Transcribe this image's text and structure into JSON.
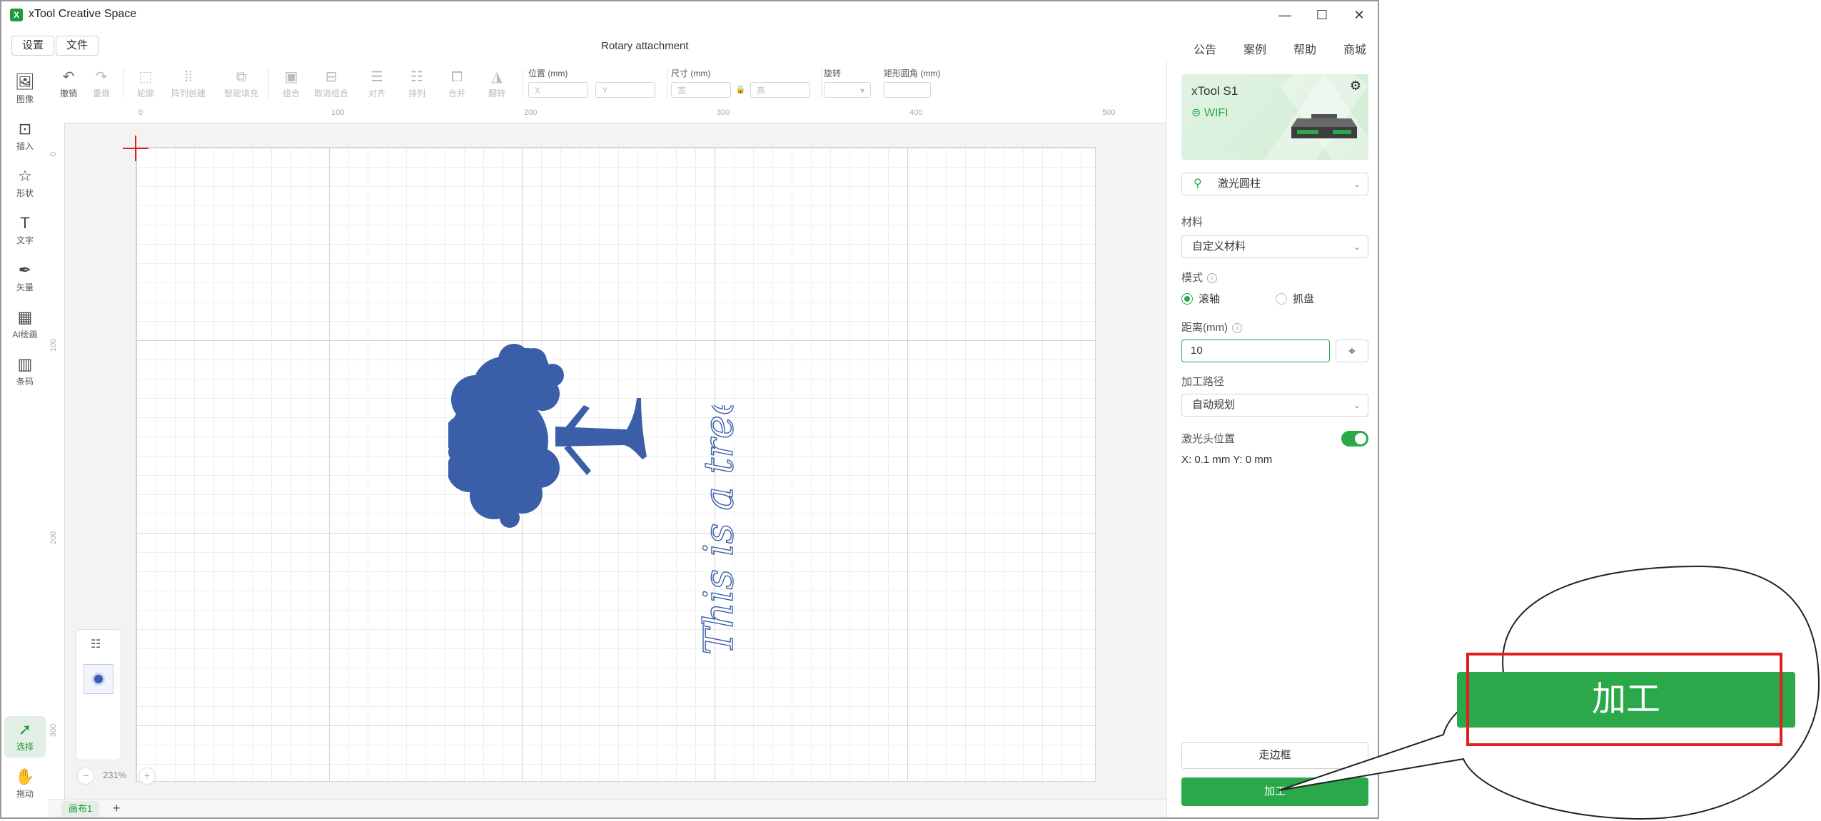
{
  "window": {
    "title": "xTool Creative Space",
    "logo_glyph": "X",
    "controls": {
      "minimize": "—",
      "maximize": "☐",
      "close": "✕"
    }
  },
  "menubar": {
    "settings": "设置",
    "file": "文件",
    "document_title": "Rotary attachment",
    "links": [
      "公告",
      "案例",
      "帮助",
      "商城"
    ]
  },
  "left_tools": [
    {
      "label": "图像",
      "icon": "image-icon"
    },
    {
      "label": "插入",
      "icon": "insert-icon"
    },
    {
      "label": "形状",
      "icon": "shape-icon"
    },
    {
      "label": "文字",
      "icon": "text-icon"
    },
    {
      "label": "矢量",
      "icon": "pen-icon"
    },
    {
      "label": "AI绘画",
      "icon": "ai-paint-icon"
    },
    {
      "label": "条码",
      "icon": "barcode-icon"
    },
    {
      "label": "选择",
      "icon": "select-icon",
      "active": true
    },
    {
      "label": "拖动",
      "icon": "hand-icon"
    }
  ],
  "toolbar": {
    "undo": "撤销",
    "redo": "重做",
    "outline": "轮廓",
    "array": "阵列创建",
    "smart_fill": "智能填充",
    "group": "组合",
    "ungroup": "取消组合",
    "align": "对齐",
    "arrange": "排列",
    "merge": "合并",
    "flip": "翻转",
    "position_label": "位置 (mm)",
    "x_placeholder": "X",
    "y_placeholder": "Y",
    "size_label": "尺寸 (mm)",
    "width_placeholder": "宽",
    "height_placeholder": "高",
    "rotate_label": "旋转",
    "corner_label": "矩形圆角 (mm)"
  },
  "rulers": {
    "top": [
      "0",
      "100",
      "200",
      "300",
      "400",
      "500"
    ],
    "left": [
      "0",
      "100",
      "200",
      "300"
    ]
  },
  "canvas": {
    "script_text": "This is a tree",
    "object_color": "#3a5ea8",
    "zoom": "231%",
    "zoom_minus": "−",
    "zoom_plus": "+",
    "tab": "画布1",
    "add_tab": "+"
  },
  "right_panel": {
    "device_name": "xTool S1",
    "connection": "WIFI",
    "accessory": "激光圆柱",
    "material_label": "材料",
    "material_value": "自定义材料",
    "mode_label": "模式",
    "mode_options": [
      "滚轴",
      "抓盘"
    ],
    "mode_selected": "滚轴",
    "distance_label": "距离(mm)",
    "distance_value": "10",
    "path_label": "加工路径",
    "path_value": "自动规划",
    "head_position_label": "激光头位置",
    "head_position_enabled": true,
    "head_position_value": "X: 0.1 mm  Y: 0 mm",
    "frame_button": "走边框",
    "process_button": "加工",
    "accent_color": "#2aa84a"
  },
  "callout": {
    "zoomed_button": "加工",
    "highlight_color": "#e0201f"
  }
}
